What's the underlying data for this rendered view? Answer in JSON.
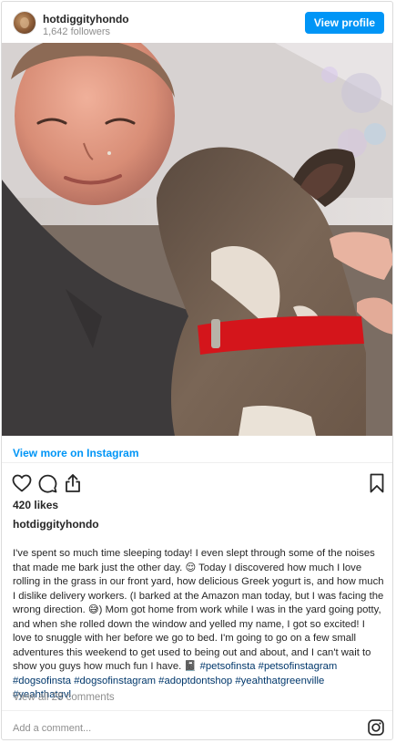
{
  "header": {
    "username": "hotdiggityhondo",
    "followers": "1,642 followers",
    "view_profile_label": "View profile"
  },
  "post": {
    "view_more_label": "View more on Instagram",
    "likes": "420 likes",
    "caption_user": "hotdiggityhondo",
    "caption_parts": [
      "I've spent so much time sleeping today! I even slept through some of the noises that made me bark just the other day. ",
      "😌",
      " Today I discovered how much I love rolling in the grass in our front yard, how delicious Greek yogurt is, and how much I dislike delivery workers. (I barked at the Amazon man today, but I was facing the wrong direction. ",
      "😅",
      ") Mom got home from work while I was in the yard going potty, and when she rolled down the window and yelled my name, I got so excited! I love to snuggle with her before we go to bed. I'm going to go on a few small adventures this weekend to get used to being out and about, and I can't wait to show you guys how much fun I have. ",
      "📓",
      " "
    ],
    "hashtags": [
      "#petsofinsta",
      "#petsofinstagram",
      "#dogsofinsta",
      "#dogsofinstagram",
      "#adoptdontshop",
      "#yeahthatgreenville",
      "#yeahthatgvl"
    ],
    "comments_link": "View all 28 comments",
    "add_comment_placeholder": "Add a comment..."
  },
  "icons": {
    "like": "heart-icon",
    "comment": "comment-icon",
    "share": "share-icon",
    "save": "bookmark-icon",
    "brand": "instagram-icon"
  },
  "colors": {
    "accent": "#0095f6",
    "hashtag": "#00376b",
    "muted": "#8e8e8e",
    "collar": "#d4151b"
  }
}
